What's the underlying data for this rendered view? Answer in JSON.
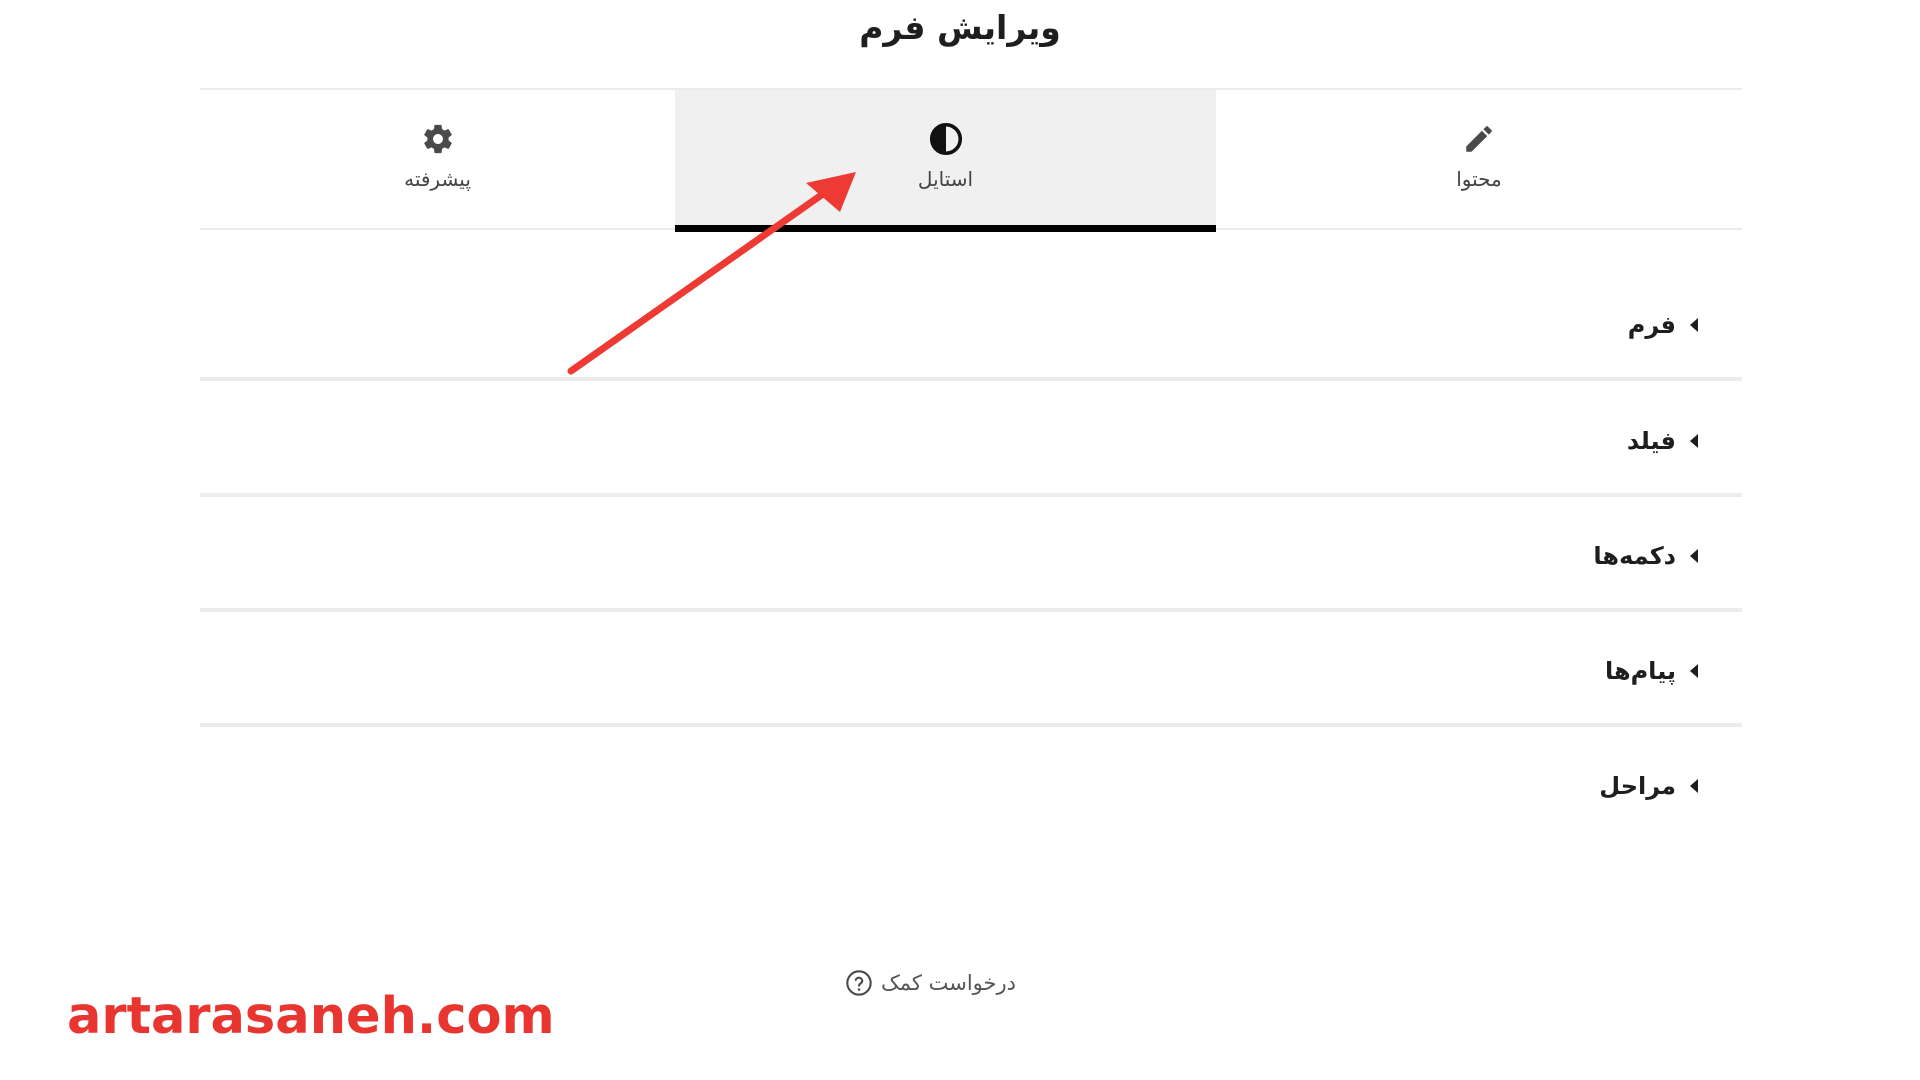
{
  "header": {
    "title": "ویرایش فرم"
  },
  "tabs": [
    {
      "id": "advanced",
      "label": "پیشرفته",
      "icon": "gear-icon"
    },
    {
      "id": "style",
      "label": "استایل",
      "icon": "contrast-icon",
      "active": true
    },
    {
      "id": "content",
      "label": "محتوا",
      "icon": "pencil-icon"
    }
  ],
  "sections": [
    {
      "label": "فرم"
    },
    {
      "label": "فیلد"
    },
    {
      "label": "دکمه‌ها"
    },
    {
      "label": "پیام‌ها"
    },
    {
      "label": "مراحل"
    }
  ],
  "help": {
    "label": "درخواست کمک",
    "icon": "question-circle-icon"
  },
  "watermark": {
    "text": "artarasaneh.com",
    "color": "#e8352f"
  },
  "annotation": {
    "icon": "red-arrow-annotation",
    "color": "#ee3a35"
  },
  "colors": {
    "active_tab_bg": "#f0f0f1",
    "active_tab_indicator": "#000000",
    "divider": "#ececec"
  }
}
